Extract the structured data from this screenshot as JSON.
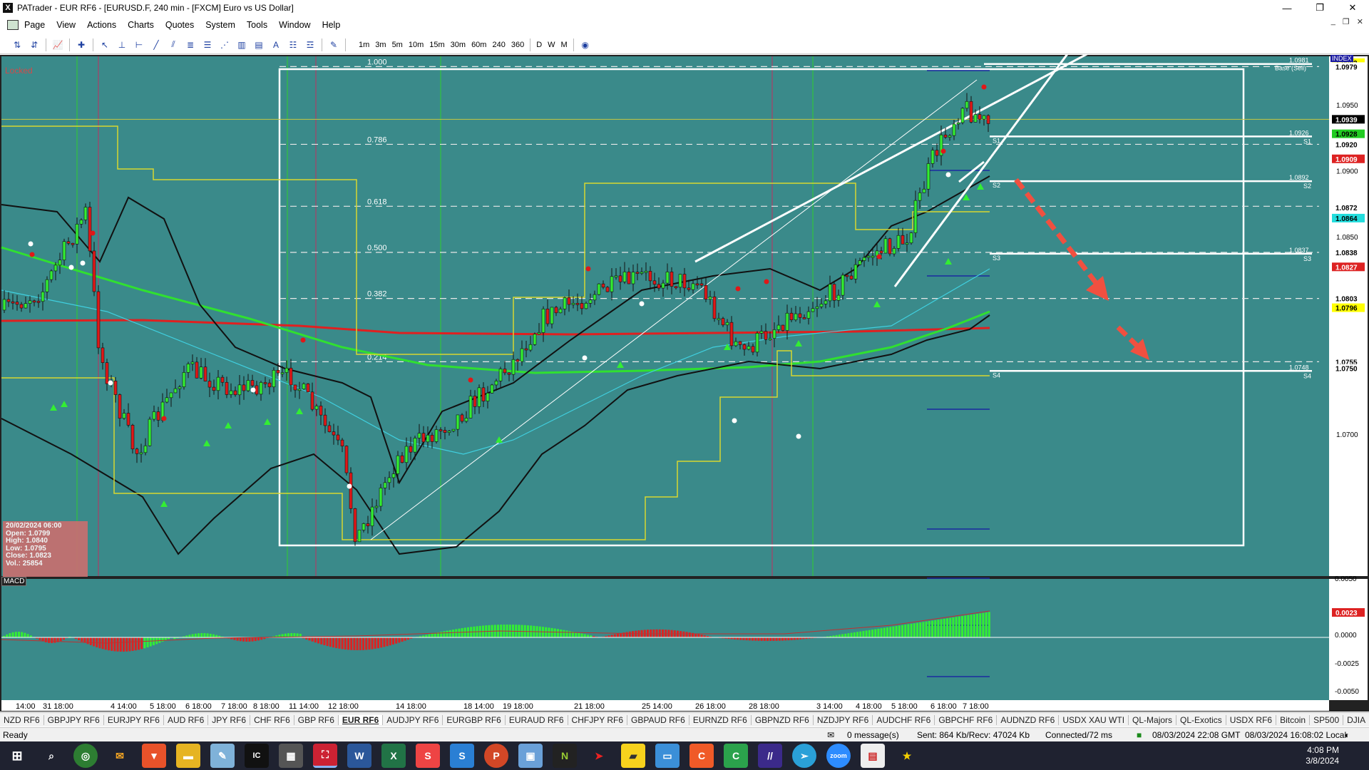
{
  "window": {
    "title": "PATrader - EUR RF6 - [EURUSD.F, 240 min - [FXCM] Euro vs US Dollar]",
    "app_icon_glyph": "X",
    "minimize": "—",
    "maximize": "❐",
    "close": "✕"
  },
  "menu": {
    "items": [
      "Page",
      "View",
      "Actions",
      "Charts",
      "Quotes",
      "System",
      "Tools",
      "Window",
      "Help"
    ],
    "mdi": [
      "_",
      "❐",
      "✕"
    ]
  },
  "toolbar": {
    "timeframes": [
      "1m",
      "3m",
      "5m",
      "10m",
      "15m",
      "30m",
      "60m",
      "240",
      "360",
      "D",
      "W",
      "M"
    ]
  },
  "chart": {
    "locked_label": "Locked",
    "index_label": "INDEX",
    "macd_label": "MACD",
    "base_label": "Base (Sell)",
    "background": "#3a8a8a",
    "fib_levels": [
      {
        "label": "1.000",
        "price": 1.0979
      },
      {
        "label": "0.786",
        "price": 1.092
      },
      {
        "label": "0.618",
        "price": 1.0873
      },
      {
        "label": "0.500",
        "price": 1.0838
      },
      {
        "label": "0.382",
        "price": 1.0803
      },
      {
        "label": "0.214",
        "price": 1.0755
      }
    ],
    "pivot_levels": [
      {
        "name": "S1",
        "price": 1.0926,
        "label": "1.0926"
      },
      {
        "name": "S2",
        "price": 1.0892,
        "label": "1.0892"
      },
      {
        "name": "S3",
        "price": 1.0837,
        "label": "1.0837"
      },
      {
        "name": "S4",
        "price": 1.0748,
        "label": "1.0748"
      },
      {
        "name": "Base",
        "price": 1.0981,
        "label": "1.0981"
      }
    ],
    "axis_ticks": [
      "1.0950",
      "1.0900",
      "1.0850",
      "1.0750",
      "1.0700"
    ],
    "axis_badges": [
      {
        "price": 1.0982,
        "label": "1.0982",
        "bg": "#ffff00",
        "fg": "#000"
      },
      {
        "price": 1.0979,
        "label": "1.0979",
        "bg": "#ffffff",
        "fg": "#000"
      },
      {
        "price": 1.0939,
        "label": "1.0939",
        "bg": "#000000",
        "fg": "#fff"
      },
      {
        "price": 1.0928,
        "label": "1.0928",
        "bg": "#22cc22",
        "fg": "#000"
      },
      {
        "price": 1.092,
        "label": "1.0920",
        "bg": "#ffffff",
        "fg": "#000"
      },
      {
        "price": 1.0909,
        "label": "1.0909",
        "bg": "#dd2222",
        "fg": "#fff"
      },
      {
        "price": 1.0872,
        "label": "1.0872",
        "bg": "#ffffff",
        "fg": "#000"
      },
      {
        "price": 1.0864,
        "label": "1.0864",
        "bg": "#22dddd",
        "fg": "#000"
      },
      {
        "price": 1.0838,
        "label": "1.0838",
        "bg": "#ffffff",
        "fg": "#000"
      },
      {
        "price": 1.0827,
        "label": "1.0827",
        "bg": "#dd2222",
        "fg": "#fff"
      },
      {
        "price": 1.0803,
        "label": "1.0803",
        "bg": "#ffffff",
        "fg": "#000"
      },
      {
        "price": 1.0796,
        "label": "1.0796",
        "bg": "#ffff00",
        "fg": "#000"
      },
      {
        "price": 1.0755,
        "label": "1.0755",
        "bg": "#ffffff",
        "fg": "#000"
      },
      {
        "price": 1.075,
        "label": "1.0750",
        "bg": "#ffffff",
        "fg": "#000"
      }
    ],
    "macd_ticks": [
      "0.0050",
      "0.0000",
      "-0.0025",
      "-0.0050"
    ],
    "macd_badge": "0.0023",
    "time_labels": [
      "14:00",
      "31 18:00",
      "4 14:00",
      "5 18:00",
      "6 18:00",
      "7 18:00",
      "8 18:00",
      "11 14:00",
      "12 18:00",
      "14 18:00",
      "18 14:00",
      "19 18:00",
      "21 18:00",
      "25 14:00",
      "26 18:00",
      "28 18:00",
      "3 14:00",
      "4 18:00",
      "5 18:00",
      "6 18:00",
      "7 18:00"
    ]
  },
  "info_box": {
    "date": "20/02/2024 06:00",
    "open": "Open: 1.0799",
    "high": "High: 1.0840",
    "low": "Low: 1.0795",
    "close": "Close: 1.0823",
    "vol": "Vol.: 25854"
  },
  "symbol_tabs": [
    "NZD RF6",
    "GBPJPY RF6",
    "EURJPY RF6",
    "AUD RF6",
    "JPY RF6",
    "CHF RF6",
    "GBP RF6",
    "EUR RF6",
    "AUDJPY RF6",
    "EURGBP RF6",
    "EURAUD RF6",
    "CHFJPY RF6",
    "GBPAUD RF6",
    "EURNZD RF6",
    "GBPNZD RF6",
    "NZDJPY RF6",
    "AUDCHF RF6",
    "GBPCHF RF6",
    "AUDNZD RF6",
    "USDX XAU WTI",
    "QL-Majors",
    "QL-Exotics",
    "USDX RF6",
    "Bitcoin",
    "SP500",
    "DJIA"
  ],
  "active_tab": "EUR RF6",
  "status": {
    "ready": "Ready",
    "messages": "0 message(s)",
    "traffic": "Sent: 864 Kb/Recv: 47024 Kb",
    "connection": "Connected/72 ms",
    "gmt": "08/03/2024 22:08 GMT",
    "local": "08/03/2024 16:08:02 Local"
  },
  "taskbar": {
    "time": "4:08 PM",
    "date": "3/8/2024"
  }
}
